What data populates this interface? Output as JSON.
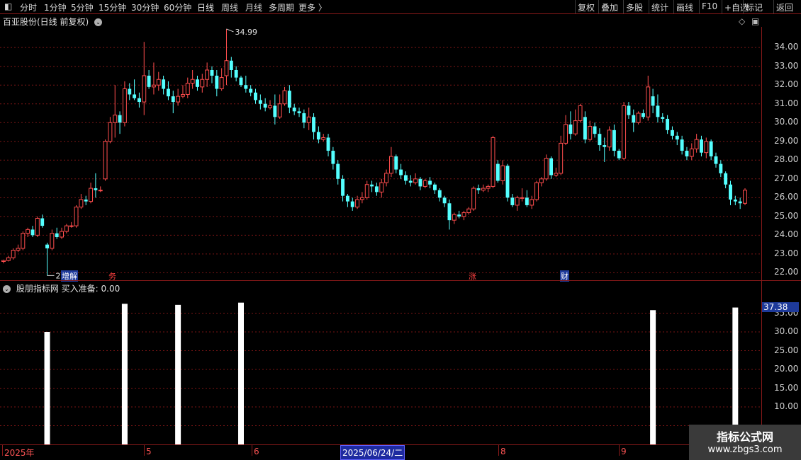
{
  "toolbar": {
    "left_items": [
      "分时",
      "1分钟",
      "5分钟",
      "15分钟",
      "30分钟",
      "60分钟",
      "日线",
      "周线",
      "月线",
      "多周期",
      "更多 〉"
    ],
    "right_items": [
      "复权",
      "叠加",
      "多股",
      "统计",
      "画线",
      "F10",
      "+自选",
      "标记",
      "返回"
    ],
    "active_index": 6
  },
  "chart_title": "百亚股份(日线 前复权)",
  "price_axis": [
    "34.00",
    "33.00",
    "32.00",
    "31.00",
    "30.00",
    "29.00",
    "28.00",
    "27.00",
    "26.00",
    "25.00",
    "24.00",
    "23.00",
    "22.00"
  ],
  "indicator": {
    "title": "股朋指标网 买入准备: 0.00",
    "last_value": "37.38",
    "axis": [
      "35.00",
      "30.00",
      "25.00",
      "20.00",
      "15.00",
      "10.00"
    ]
  },
  "annotations": {
    "high": "34.99",
    "low": "21.85"
  },
  "events": [
    {
      "label": "增",
      "color": "#2050c8"
    },
    {
      "label": "解",
      "color": "#2050c8"
    },
    {
      "label": "务",
      "color": "#d02020"
    },
    {
      "label": "涨",
      "color": "#d02020"
    },
    {
      "label": "财",
      "color": "#2050c8"
    }
  ],
  "date_axis": {
    "labels": [
      "2025年",
      "5",
      "6",
      "8",
      "9"
    ],
    "selected": "2025/06/24/二"
  },
  "watermark": {
    "title": "指标公式网",
    "url": "www.zbgs3.com"
  },
  "colors": {
    "up": "#ff4d4d",
    "down": "#54ffff",
    "grid": "#7a1515",
    "bg": "#000000"
  },
  "chart_data": {
    "type": "candlestick",
    "ylim": [
      21.6,
      35.1
    ],
    "candles": [
      [
        22.6,
        22.65,
        22.5,
        22.7
      ],
      [
        22.65,
        22.8,
        22.6,
        22.9
      ],
      [
        22.8,
        23.2,
        22.7,
        23.3
      ],
      [
        23.2,
        23.3,
        23.1,
        23.5
      ],
      [
        23.3,
        24.1,
        23.2,
        24.2
      ],
      [
        24.1,
        24.3,
        23.9,
        24.4
      ],
      [
        24.3,
        24.0,
        23.9,
        24.5
      ],
      [
        24.0,
        24.9,
        23.9,
        25.0
      ],
      [
        24.9,
        24.5,
        24.4,
        25.1
      ],
      [
        23.5,
        23.3,
        21.85,
        23.6
      ],
      [
        23.3,
        24.1,
        23.2,
        24.3
      ],
      [
        24.1,
        23.9,
        23.8,
        24.4
      ],
      [
        23.9,
        24.2,
        23.8,
        24.4
      ],
      [
        24.2,
        24.5,
        24.1,
        24.6
      ],
      [
        24.5,
        24.5,
        24.4,
        24.7
      ],
      [
        24.5,
        25.5,
        24.4,
        25.6
      ],
      [
        25.5,
        25.9,
        25.4,
        26.2
      ],
      [
        25.9,
        25.8,
        25.6,
        26.1
      ],
      [
        25.8,
        26.5,
        25.7,
        26.8
      ],
      [
        26.5,
        26.4,
        26.0,
        27.3
      ],
      [
        26.4,
        26.4,
        26.3,
        26.6
      ],
      [
        27.0,
        29.0,
        26.9,
        29.1
      ],
      [
        29.0,
        30.0,
        28.9,
        30.3
      ],
      [
        30.0,
        30.4,
        29.2,
        32.0
      ],
      [
        30.4,
        30.0,
        29.4,
        30.6
      ],
      [
        30.0,
        31.8,
        29.8,
        32.2
      ],
      [
        31.8,
        31.5,
        31.2,
        32.1
      ],
      [
        31.5,
        31.3,
        31.2,
        32.3
      ],
      [
        31.3,
        31.1,
        30.8,
        31.6
      ],
      [
        31.1,
        32.5,
        30.4,
        34.3
      ],
      [
        32.5,
        31.9,
        31.8,
        32.8
      ],
      [
        31.9,
        32.0,
        31.5,
        33.2
      ],
      [
        32.0,
        32.3,
        31.7,
        32.7
      ],
      [
        32.3,
        31.8,
        31.5,
        32.5
      ],
      [
        31.8,
        31.4,
        31.2,
        32.2
      ],
      [
        31.4,
        31.1,
        30.5,
        31.7
      ],
      [
        31.1,
        31.4,
        30.9,
        31.8
      ],
      [
        31.4,
        31.5,
        31.3,
        32.0
      ],
      [
        31.5,
        32.1,
        31.3,
        32.4
      ],
      [
        32.1,
        32.3,
        31.8,
        32.8
      ],
      [
        32.3,
        31.9,
        31.7,
        32.5
      ],
      [
        31.9,
        32.3,
        31.6,
        32.6
      ],
      [
        32.3,
        32.8,
        31.9,
        33.2
      ],
      [
        32.8,
        32.5,
        32.1,
        33.0
      ],
      [
        32.5,
        31.8,
        31.4,
        32.8
      ],
      [
        31.8,
        32.4,
        31.7,
        32.9
      ],
      [
        32.5,
        33.3,
        32.0,
        34.99
      ],
      [
        33.3,
        32.8,
        32.4,
        33.5
      ],
      [
        32.8,
        32.4,
        32.2,
        33.0
      ],
      [
        32.4,
        32.0,
        31.9,
        32.5
      ],
      [
        32.0,
        31.8,
        31.6,
        32.5
      ],
      [
        31.8,
        31.6,
        31.4,
        32.0
      ],
      [
        31.6,
        31.2,
        31.0,
        31.8
      ],
      [
        31.2,
        31.0,
        30.7,
        31.5
      ],
      [
        31.0,
        30.8,
        30.6,
        31.3
      ],
      [
        30.8,
        30.9,
        30.7,
        31.2
      ],
      [
        30.9,
        30.3,
        29.9,
        31.5
      ],
      [
        30.3,
        31.0,
        30.2,
        31.5
      ],
      [
        31.0,
        31.7,
        30.9,
        31.9
      ],
      [
        31.7,
        30.8,
        30.5,
        32.0
      ],
      [
        30.8,
        30.6,
        30.4,
        31.0
      ],
      [
        30.6,
        30.5,
        30.3,
        30.8
      ],
      [
        30.5,
        30.0,
        29.7,
        30.7
      ],
      [
        30.0,
        30.3,
        29.6,
        30.8
      ],
      [
        30.3,
        29.5,
        29.1,
        30.5
      ],
      [
        29.5,
        29.1,
        28.9,
        29.8
      ],
      [
        29.1,
        29.2,
        29.0,
        29.4
      ],
      [
        29.2,
        28.5,
        28.2,
        29.4
      ],
      [
        28.5,
        27.8,
        27.5,
        28.7
      ],
      [
        27.8,
        27.0,
        26.7,
        28.0
      ],
      [
        27.0,
        26.1,
        25.8,
        27.2
      ],
      [
        26.1,
        25.8,
        25.5,
        26.2
      ],
      [
        25.8,
        25.5,
        25.3,
        26.0
      ],
      [
        25.5,
        25.9,
        25.4,
        26.1
      ],
      [
        25.9,
        26.0,
        25.7,
        26.3
      ],
      [
        26.0,
        26.7,
        25.9,
        26.9
      ],
      [
        26.7,
        26.6,
        26.3,
        26.9
      ],
      [
        26.6,
        26.3,
        26.1,
        26.8
      ],
      [
        26.3,
        26.8,
        26.0,
        27.0
      ],
      [
        26.8,
        27.3,
        26.6,
        27.5
      ],
      [
        27.3,
        28.2,
        27.1,
        28.7
      ],
      [
        28.2,
        27.5,
        27.3,
        28.3
      ],
      [
        27.5,
        27.2,
        27.0,
        27.8
      ],
      [
        27.2,
        26.9,
        26.7,
        27.4
      ],
      [
        26.9,
        26.8,
        26.6,
        27.2
      ],
      [
        26.8,
        27.0,
        26.7,
        27.3
      ],
      [
        27.0,
        26.6,
        26.4,
        27.1
      ],
      [
        26.6,
        26.9,
        26.5,
        27.0
      ],
      [
        26.9,
        26.7,
        26.5,
        27.1
      ],
      [
        26.7,
        26.4,
        26.2,
        26.8
      ],
      [
        26.4,
        26.0,
        25.8,
        26.5
      ],
      [
        26.0,
        25.7,
        25.5,
        26.1
      ],
      [
        25.7,
        24.8,
        24.3,
        25.9
      ],
      [
        24.8,
        25.1,
        24.6,
        25.2
      ],
      [
        25.1,
        25.0,
        24.9,
        25.3
      ],
      [
        25.0,
        25.2,
        24.8,
        25.3
      ],
      [
        25.2,
        25.4,
        25.1,
        25.5
      ],
      [
        25.4,
        26.5,
        25.3,
        26.6
      ],
      [
        26.5,
        26.4,
        26.2,
        26.7
      ],
      [
        26.4,
        26.5,
        26.3,
        26.7
      ],
      [
        26.5,
        26.6,
        26.3,
        26.7
      ],
      [
        26.6,
        29.2,
        26.5,
        29.3
      ],
      [
        27.8,
        26.9,
        26.8,
        28.0
      ],
      [
        26.9,
        27.7,
        26.7,
        28.0
      ],
      [
        27.7,
        26.0,
        25.8,
        27.8
      ],
      [
        26.0,
        25.6,
        25.5,
        26.2
      ],
      [
        25.6,
        26.0,
        25.3,
        26.1
      ],
      [
        26.0,
        26.0,
        25.8,
        26.5
      ],
      [
        26.0,
        25.6,
        25.5,
        26.4
      ],
      [
        25.6,
        25.9,
        25.4,
        26.1
      ],
      [
        25.9,
        26.8,
        25.8,
        26.9
      ],
      [
        26.8,
        27.0,
        26.6,
        27.1
      ],
      [
        27.0,
        28.1,
        26.9,
        28.3
      ],
      [
        28.1,
        27.2,
        27.0,
        28.2
      ],
      [
        27.2,
        27.3,
        27.1,
        27.6
      ],
      [
        27.3,
        28.9,
        27.2,
        29.3
      ],
      [
        28.9,
        29.9,
        28.8,
        30.4
      ],
      [
        29.9,
        29.4,
        29.1,
        30.6
      ],
      [
        29.4,
        30.1,
        29.3,
        30.7
      ],
      [
        30.1,
        30.9,
        30.0,
        31.0
      ],
      [
        30.3,
        29.1,
        28.9,
        30.6
      ],
      [
        29.1,
        29.8,
        29.0,
        30.1
      ],
      [
        29.8,
        29.4,
        29.2,
        30.0
      ],
      [
        29.4,
        28.8,
        28.5,
        29.7
      ],
      [
        28.8,
        28.7,
        27.9,
        29.2
      ],
      [
        28.7,
        29.6,
        28.5,
        29.8
      ],
      [
        29.6,
        28.5,
        28.2,
        29.9
      ],
      [
        28.5,
        28.1,
        28.0,
        28.6
      ],
      [
        28.1,
        30.9,
        28.0,
        31.1
      ],
      [
        30.9,
        30.4,
        30.2,
        31.1
      ],
      [
        30.4,
        30.0,
        29.5,
        30.7
      ],
      [
        30.0,
        30.5,
        29.9,
        30.6
      ],
      [
        30.5,
        30.3,
        30.2,
        30.7
      ],
      [
        30.3,
        31.9,
        30.1,
        32.5
      ],
      [
        31.4,
        30.9,
        30.5,
        31.8
      ],
      [
        30.9,
        30.3,
        30.0,
        31.5
      ],
      [
        30.3,
        30.2,
        30.0,
        30.5
      ],
      [
        30.2,
        29.6,
        29.4,
        30.4
      ],
      [
        29.6,
        29.3,
        29.1,
        29.8
      ],
      [
        29.3,
        29.1,
        28.8,
        29.5
      ],
      [
        29.1,
        28.5,
        28.3,
        29.3
      ],
      [
        28.5,
        28.2,
        28.0,
        28.7
      ],
      [
        28.2,
        28.6,
        28.0,
        28.9
      ],
      [
        28.6,
        29.1,
        28.4,
        29.4
      ],
      [
        29.1,
        28.4,
        28.2,
        29.3
      ],
      [
        28.4,
        29.0,
        28.1,
        29.2
      ],
      [
        29.0,
        28.2,
        28.0,
        29.1
      ],
      [
        28.2,
        27.8,
        27.6,
        28.4
      ],
      [
        27.8,
        27.3,
        27.1,
        28.0
      ],
      [
        27.3,
        26.7,
        26.5,
        27.4
      ],
      [
        26.7,
        25.9,
        25.6,
        26.9
      ],
      [
        25.9,
        25.8,
        25.6,
        26.1
      ],
      [
        25.8,
        25.7,
        25.4,
        26.0
      ],
      [
        25.7,
        26.4,
        25.6,
        26.5
      ]
    ],
    "indicator_series": {
      "name": "买入准备",
      "ylim": [
        0,
        40
      ],
      "bars": [
        {
          "candle_index": 9,
          "value": 30.0
        },
        {
          "candle_index": 25,
          "value": 37.5
        },
        {
          "candle_index": 36,
          "value": 37.2
        },
        {
          "candle_index": 49,
          "value": 37.8
        },
        {
          "candle_index": 134,
          "value": 35.8
        },
        {
          "candle_index": 151,
          "value": 36.5
        }
      ]
    }
  }
}
